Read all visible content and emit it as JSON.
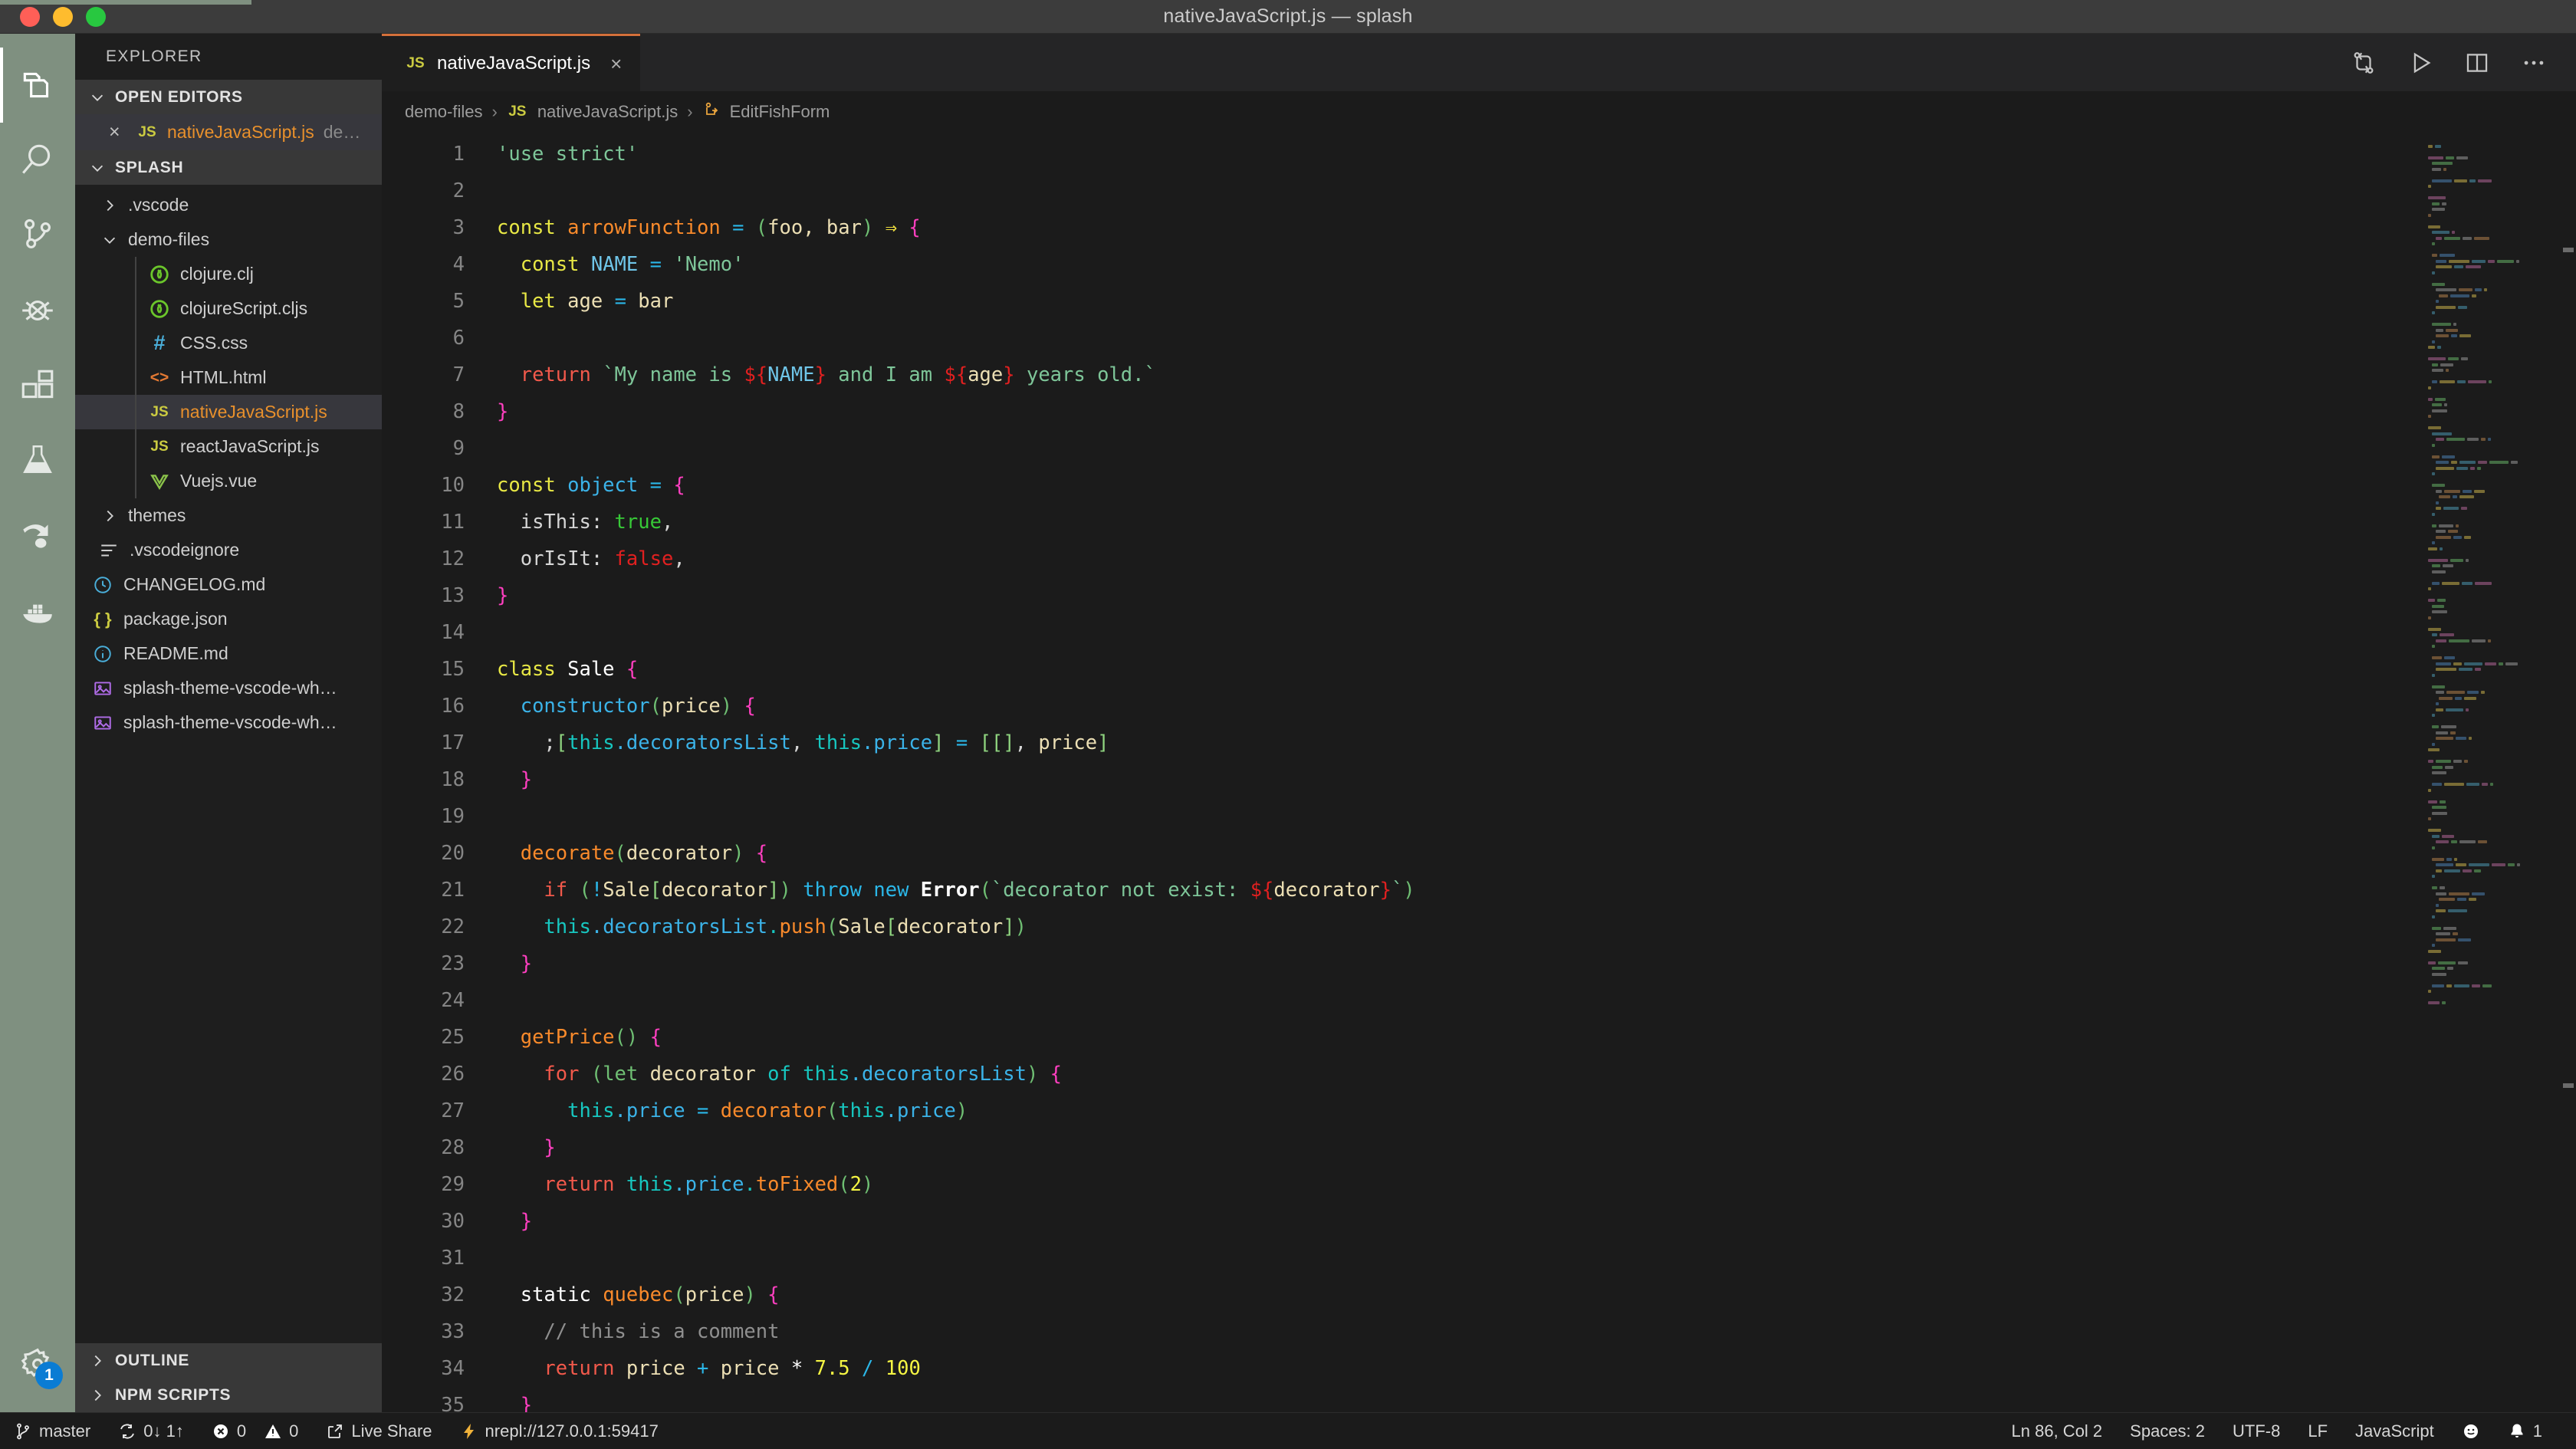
{
  "window": {
    "title": "nativeJavaScript.js — splash",
    "traffic_lights": [
      "close",
      "minimize",
      "maximize"
    ]
  },
  "activity_bar": {
    "items": [
      {
        "name": "explorer",
        "icon": "files-icon",
        "active": true
      },
      {
        "name": "search",
        "icon": "search-icon",
        "active": false
      },
      {
        "name": "source-control",
        "icon": "source-control-icon",
        "active": false
      },
      {
        "name": "run-and-debug",
        "icon": "debug-icon",
        "active": false
      },
      {
        "name": "extensions",
        "icon": "extensions-icon",
        "active": false
      },
      {
        "name": "testing",
        "icon": "beaker-icon",
        "active": false
      },
      {
        "name": "live-share",
        "icon": "live-share-icon",
        "active": false
      },
      {
        "name": "docker",
        "icon": "docker-icon",
        "active": false
      }
    ],
    "manage": {
      "icon": "gear-icon",
      "badge": "1",
      "badge_color": "#0a7cd4"
    }
  },
  "sidebar": {
    "title": "EXPLORER",
    "sections": {
      "open_editors": {
        "label": "OPEN EDITORS",
        "expanded": true,
        "items": [
          {
            "name": "nativeJavaScript.js",
            "suffix": "de…",
            "icon": "js-icon",
            "active": true,
            "close": "×"
          }
        ]
      },
      "splash": {
        "label": "SPLASH",
        "expanded": true
      },
      "outline": {
        "label": "OUTLINE",
        "expanded": false
      },
      "npm_scripts": {
        "label": "NPM SCRIPTS",
        "expanded": false
      }
    },
    "tree": [
      {
        "label": ".vscode",
        "type": "folder",
        "expanded": false,
        "indent": 1
      },
      {
        "label": "demo-files",
        "type": "folder",
        "expanded": true,
        "indent": 1
      },
      {
        "label": "clojure.clj",
        "type": "file",
        "icon": "clojure-icon",
        "indent": 2
      },
      {
        "label": "clojureScript.cljs",
        "type": "file",
        "icon": "clojure-icon",
        "indent": 2
      },
      {
        "label": "CSS.css",
        "type": "file",
        "icon": "css-icon",
        "indent": 2
      },
      {
        "label": "HTML.html",
        "type": "file",
        "icon": "html-icon",
        "indent": 2
      },
      {
        "label": "nativeJavaScript.js",
        "type": "file",
        "icon": "js-icon",
        "indent": 2,
        "selected": true
      },
      {
        "label": "reactJavaScript.js",
        "type": "file",
        "icon": "js-icon",
        "indent": 2
      },
      {
        "label": "Vuejs.vue",
        "type": "file",
        "icon": "vue-icon",
        "indent": 2
      },
      {
        "label": "themes",
        "type": "folder",
        "expanded": false,
        "indent": 1
      },
      {
        "label": ".vscodeignore",
        "type": "file",
        "icon": "settings-icon",
        "indent": 1
      },
      {
        "label": "CHANGELOG.md",
        "type": "file",
        "icon": "clock-icon",
        "indent": 1
      },
      {
        "label": "package.json",
        "type": "file",
        "icon": "json-icon",
        "indent": 1
      },
      {
        "label": "README.md",
        "type": "file",
        "icon": "info-icon",
        "indent": 1
      },
      {
        "label": "splash-theme-vscode-wh…",
        "type": "file",
        "icon": "image-icon",
        "indent": 1
      },
      {
        "label": "splash-theme-vscode-wh…",
        "type": "file",
        "icon": "image-icon",
        "indent": 1
      }
    ]
  },
  "editor": {
    "tabs": [
      {
        "label": "nativeJavaScript.js",
        "icon": "js-icon",
        "active": true,
        "close": "×"
      }
    ],
    "actions": [
      {
        "name": "split-terminal-icon"
      },
      {
        "name": "run-icon"
      },
      {
        "name": "split-editor-icon"
      },
      {
        "name": "more-actions-icon"
      }
    ],
    "breadcrumb": [
      {
        "label": "demo-files",
        "icon": null
      },
      {
        "label": "nativeJavaScript.js",
        "icon": "js-icon"
      },
      {
        "label": "EditFishForm",
        "icon": "class-symbol-icon"
      }
    ],
    "first_line": 1,
    "code_lines": [
      {
        "n": 1,
        "text": "'use strict'"
      },
      {
        "n": 2,
        "text": ""
      },
      {
        "n": 3,
        "text": "const arrowFunction = (foo, bar) ⇒ {"
      },
      {
        "n": 4,
        "text": "  const NAME = 'Nemo'"
      },
      {
        "n": 5,
        "text": "  let age = bar"
      },
      {
        "n": 6,
        "text": ""
      },
      {
        "n": 7,
        "text": "  return `My name is ${NAME} and I am ${age} years old.`"
      },
      {
        "n": 8,
        "text": "}"
      },
      {
        "n": 9,
        "text": ""
      },
      {
        "n": 10,
        "text": "const object = {"
      },
      {
        "n": 11,
        "text": "  isThis: true,"
      },
      {
        "n": 12,
        "text": "  orIsIt: false,"
      },
      {
        "n": 13,
        "text": "}"
      },
      {
        "n": 14,
        "text": ""
      },
      {
        "n": 15,
        "text": "class Sale {"
      },
      {
        "n": 16,
        "text": "  constructor(price) {"
      },
      {
        "n": 17,
        "text": "    ;[this.decoratorsList, this.price] = [[], price]"
      },
      {
        "n": 18,
        "text": "  }"
      },
      {
        "n": 19,
        "text": ""
      },
      {
        "n": 20,
        "text": "  decorate(decorator) {"
      },
      {
        "n": 21,
        "text": "    if (!Sale[decorator]) throw new Error(`decorator not exist: ${decorator}`)"
      },
      {
        "n": 22,
        "text": "    this.decoratorsList.push(Sale[decorator])"
      },
      {
        "n": 23,
        "text": "  }"
      },
      {
        "n": 24,
        "text": ""
      },
      {
        "n": 25,
        "text": "  getPrice() {"
      },
      {
        "n": 26,
        "text": "    for (let decorator of this.decoratorsList) {"
      },
      {
        "n": 27,
        "text": "      this.price = decorator(this.price)"
      },
      {
        "n": 28,
        "text": "    }"
      },
      {
        "n": 29,
        "text": "    return this.price.toFixed(2)"
      },
      {
        "n": 30,
        "text": "  }"
      },
      {
        "n": 31,
        "text": ""
      },
      {
        "n": 32,
        "text": "  static quebec(price) {"
      },
      {
        "n": 33,
        "text": "    // this is a comment"
      },
      {
        "n": 34,
        "text": "    return price + price * 7.5 / 100"
      },
      {
        "n": 35,
        "text": "  }"
      }
    ]
  },
  "status_bar": {
    "left": [
      {
        "name": "branch",
        "icon": "source-control-icon",
        "label": "master"
      },
      {
        "name": "sync",
        "icon": "sync-icon",
        "label": "0↓ 1↑"
      },
      {
        "name": "problems",
        "icon": "error-icon",
        "label": "0",
        "icon2": "warning-icon",
        "label2": "0"
      },
      {
        "name": "live-share",
        "icon": "live-share-icon",
        "label": "Live Share"
      },
      {
        "name": "nrepl",
        "icon": "zap-icon",
        "label": "nrepl://127.0.0.1:59417"
      }
    ],
    "right": [
      {
        "name": "cursor-position",
        "label": "Ln 86, Col 2"
      },
      {
        "name": "indentation",
        "label": "Spaces: 2"
      },
      {
        "name": "encoding",
        "label": "UTF-8"
      },
      {
        "name": "eol",
        "label": "LF"
      },
      {
        "name": "language-mode",
        "label": "JavaScript"
      },
      {
        "name": "feedback",
        "icon": "smiley-icon",
        "label": ""
      },
      {
        "name": "notifications",
        "icon": "bell-icon",
        "label": "1"
      }
    ]
  },
  "theme": {
    "activity_bar_bg": "#7f9080",
    "sidebar_bg": "#1e1e1e",
    "editor_bg": "#1b1b1b",
    "tab_active_border": "#d4703a",
    "accent_orange": "#e8902c",
    "badge_blue": "#0a7cd4"
  }
}
